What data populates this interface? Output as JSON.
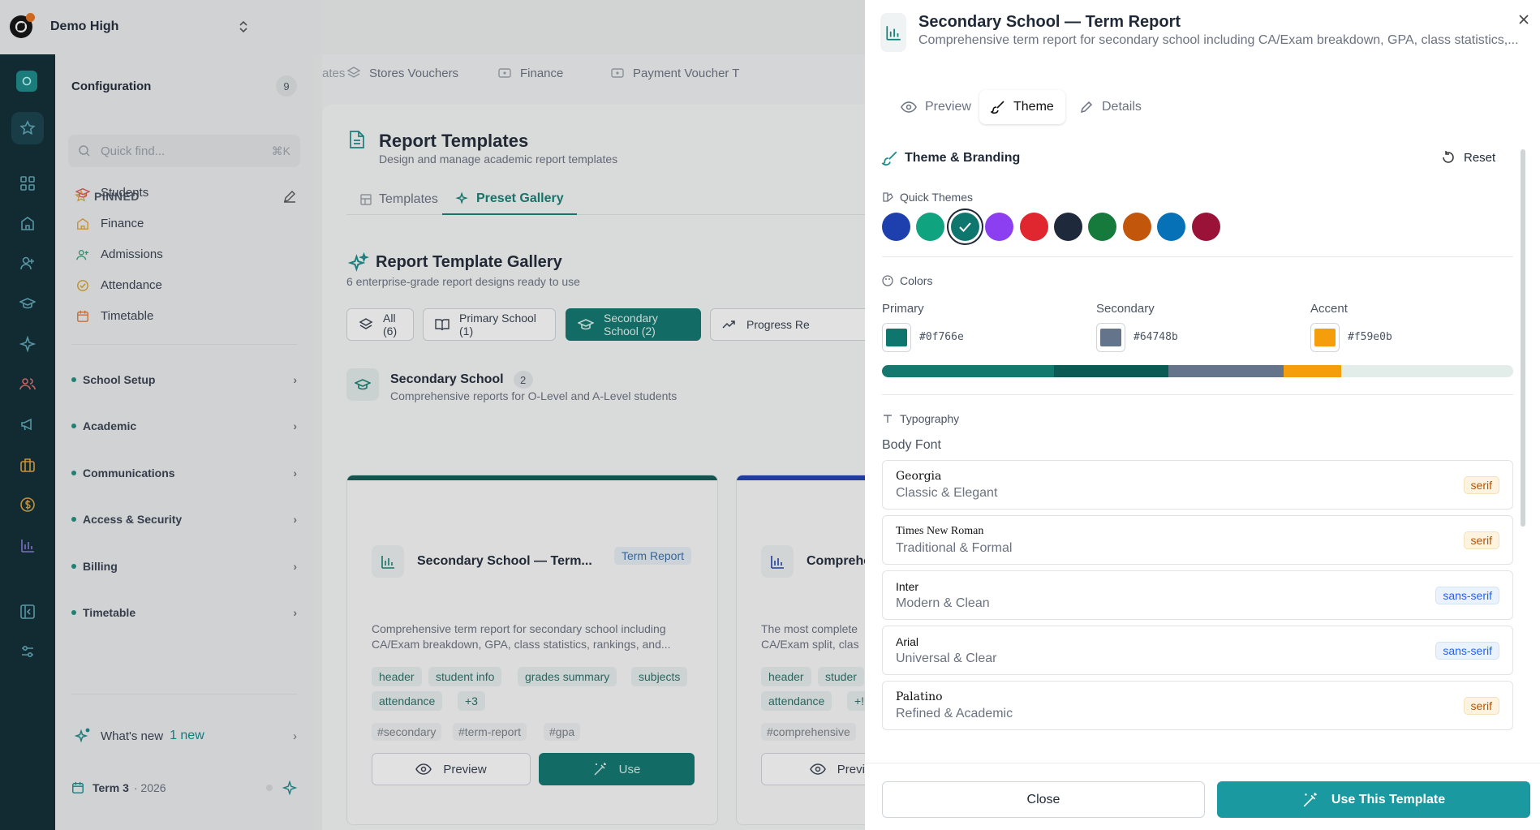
{
  "brand": {
    "name": "Demo High"
  },
  "sidebar": {
    "title": "Configuration",
    "count": "9",
    "search": {
      "placeholder": "Quick find...",
      "shortcut": "⌘K"
    },
    "pinned_label": "PINNED",
    "pinned": [
      {
        "label": "Students",
        "icon": "graduation-cap-icon",
        "color": "#e05a5a"
      },
      {
        "label": "Finance",
        "icon": "building-icon",
        "color": "#e0a43c"
      },
      {
        "label": "Admissions",
        "icon": "user-plus-icon",
        "color": "#3aa37a"
      },
      {
        "label": "Attendance",
        "icon": "check-circle-icon",
        "color": "#d6a12b"
      },
      {
        "label": "Timetable",
        "icon": "calendar-icon",
        "color": "#e07b3c"
      }
    ],
    "groups": [
      {
        "label": "School Setup"
      },
      {
        "label": "Academic"
      },
      {
        "label": "Communications"
      },
      {
        "label": "Access & Security"
      },
      {
        "label": "Billing"
      },
      {
        "label": "Timetable"
      }
    ],
    "whats_new": "What's new",
    "new_count": "1 new",
    "term": "Term 3",
    "year": "· 2026"
  },
  "main": {
    "top_tabs": [
      {
        "label": "ates"
      },
      {
        "label": "Stores Vouchers"
      },
      {
        "label": "Finance"
      },
      {
        "label": "Payment Voucher T"
      }
    ],
    "title": "Report Templates",
    "subtitle": "Design and manage academic report templates",
    "tabs": [
      {
        "label": "Templates"
      },
      {
        "label": "Preset Gallery"
      }
    ],
    "gallery_title": "Report Template Gallery",
    "gallery_sub": "6 enterprise-grade report designs ready to use",
    "filters": [
      {
        "label": "All (6)"
      },
      {
        "label": "Primary School (1)"
      },
      {
        "label": "Secondary School (2)"
      },
      {
        "label": "Progress Re"
      }
    ],
    "section": {
      "title": "Secondary School",
      "count": "2",
      "subtitle": "Comprehensive reports for O-Level and A-Level students"
    },
    "cards": [
      {
        "title": "Secondary School — Term...",
        "badge": "Term Report",
        "desc": "Comprehensive term report for secondary school including CA/Exam breakdown, GPA, class statistics, rankings, and...",
        "tags": [
          "header",
          "student info",
          "grades summary",
          "subjects",
          "attendance",
          "+3"
        ],
        "hashtags": [
          "#secondary",
          "#term-report",
          "#gpa"
        ],
        "preview": "Preview",
        "use": "Use"
      },
      {
        "title": "Comprehe",
        "desc": "The most complete\nCA/Exam split, clas",
        "tags": [
          "header",
          "studer",
          "attendance",
          "+!"
        ],
        "hashtags": [
          "#comprehensive"
        ],
        "preview": "Previe"
      }
    ]
  },
  "drawer": {
    "title": "Secondary School — Term Report",
    "subtitle": "Comprehensive term report for secondary school including CA/Exam breakdown, GPA, class statistics,...",
    "tabs": [
      {
        "label": "Preview"
      },
      {
        "label": "Theme"
      },
      {
        "label": "Details"
      }
    ],
    "theme_title": "Theme & Branding",
    "reset": "Reset",
    "quick_themes": "Quick Themes",
    "swatches": [
      "#1e40af",
      "#10a37f",
      "#0f766e",
      "#8b3ff0",
      "#e0262e",
      "#1e293b",
      "#157a3c",
      "#c2570c",
      "#0671b7",
      "#9b1238"
    ],
    "colors_title": "Colors",
    "colors": [
      {
        "label": "Primary",
        "hex": "#0f766e"
      },
      {
        "label": "Secondary",
        "hex": "#64748b"
      },
      {
        "label": "Accent",
        "hex": "#f59e0b"
      }
    ],
    "typography": "Typography",
    "body_font": "Body Font",
    "fonts": [
      {
        "name": "Georgia",
        "desc": "Classic & Elegant",
        "type": "serif"
      },
      {
        "name": "Times New Roman",
        "desc": "Traditional & Formal",
        "type": "serif"
      },
      {
        "name": "Inter",
        "desc": "Modern & Clean",
        "type": "sans-serif"
      },
      {
        "name": "Arial",
        "desc": "Universal & Clear",
        "type": "sans-serif"
      },
      {
        "name": "Palatino",
        "desc": "Refined & Academic",
        "type": "serif"
      }
    ],
    "close": "Close",
    "use": "Use This Template"
  }
}
